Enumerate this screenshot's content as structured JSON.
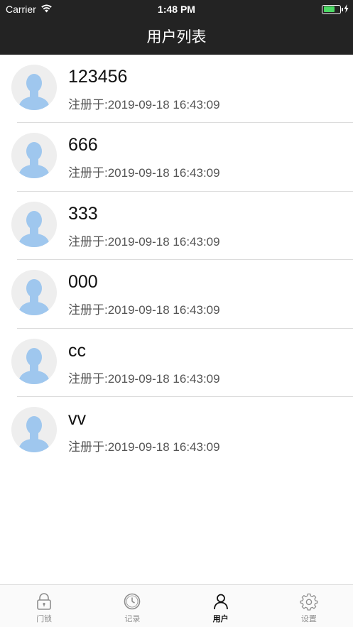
{
  "status_bar": {
    "carrier": "Carrier",
    "time": "1:48 PM"
  },
  "nav": {
    "title": "用户列表"
  },
  "users": [
    {
      "name": "123456",
      "registered": "注册于:2019-09-18 16:43:09"
    },
    {
      "name": "666",
      "registered": "注册于:2019-09-18 16:43:09"
    },
    {
      "name": "333",
      "registered": "注册于:2019-09-18 16:43:09"
    },
    {
      "name": "000",
      "registered": "注册于:2019-09-18 16:43:09"
    },
    {
      "name": "cc",
      "registered": "注册于:2019-09-18 16:43:09"
    },
    {
      "name": "vv",
      "registered": "注册于:2019-09-18 16:43:09"
    }
  ],
  "tabbar": {
    "tabs": [
      {
        "label": "门锁",
        "icon": "lock-icon",
        "active": false
      },
      {
        "label": "记录",
        "icon": "clock-icon",
        "active": false
      },
      {
        "label": "用户",
        "icon": "user-icon",
        "active": true
      },
      {
        "label": "设置",
        "icon": "gear-icon",
        "active": false
      }
    ]
  },
  "colors": {
    "header_bg": "#232323",
    "avatar_bg": "#eeeeee",
    "avatar_figure": "#9fc7ee",
    "active_tab": "#111111",
    "inactive_tab": "#8e8e8e"
  }
}
